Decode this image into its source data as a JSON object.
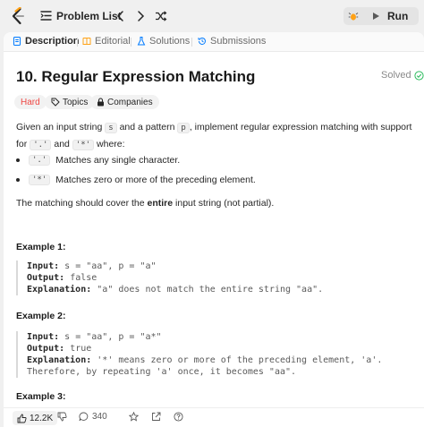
{
  "topbar": {
    "problem_list_label": "Problem List",
    "run_label": "Run"
  },
  "tabs": [
    {
      "label": "Description",
      "active": true
    },
    {
      "label": "Editorial"
    },
    {
      "label": "Solutions"
    },
    {
      "label": "Submissions"
    }
  ],
  "problem": {
    "title": "10. Regular Expression Matching",
    "status": "Solved",
    "difficulty": "Hard",
    "topics_label": "Topics",
    "companies_label": "Companies"
  },
  "description": {
    "intro_1": "Given an input string",
    "code_s": "s",
    "intro_2": "and a pattern",
    "code_p": "p",
    "intro_3": ", implement regular expression matching with support for",
    "code_dot": "'.'",
    "intro_and": "and",
    "code_star": "'*'",
    "intro_4": "where:",
    "bullets": [
      {
        "code": "'.'",
        "text": "Matches any single character."
      },
      {
        "code": "'*'",
        "text": "Matches zero or more of the preceding element."
      }
    ],
    "coverage_1": "The matching should cover the",
    "coverage_bold": "entire",
    "coverage_2": "input string (not partial)."
  },
  "examples": [
    {
      "heading": "Example 1:",
      "input_label": "Input:",
      "input_value": "s = \"aa\", p = \"a\"",
      "output_label": "Output:",
      "output_value": "false",
      "explanation_label": "Explanation:",
      "explanation_value": "\"a\" does not match the entire string \"aa\"."
    },
    {
      "heading": "Example 2:",
      "input_label": "Input:",
      "input_value": "s = \"aa\", p = \"a*\"",
      "output_label": "Output:",
      "output_value": "true",
      "explanation_label": "Explanation:",
      "explanation_value": "'*' means zero or more of the preceding element, 'a'.",
      "explanation_value_2": "Therefore, by repeating 'a' once, it becomes \"aa\"."
    },
    {
      "heading": "Example 3:"
    }
  ],
  "footer": {
    "likes": "12.2K",
    "comments": "340"
  },
  "colors": {
    "hard": "#ef4743",
    "logo_orange": "#ffa116",
    "run_icon": "#595959",
    "solved_check": "#2cbb5d"
  }
}
